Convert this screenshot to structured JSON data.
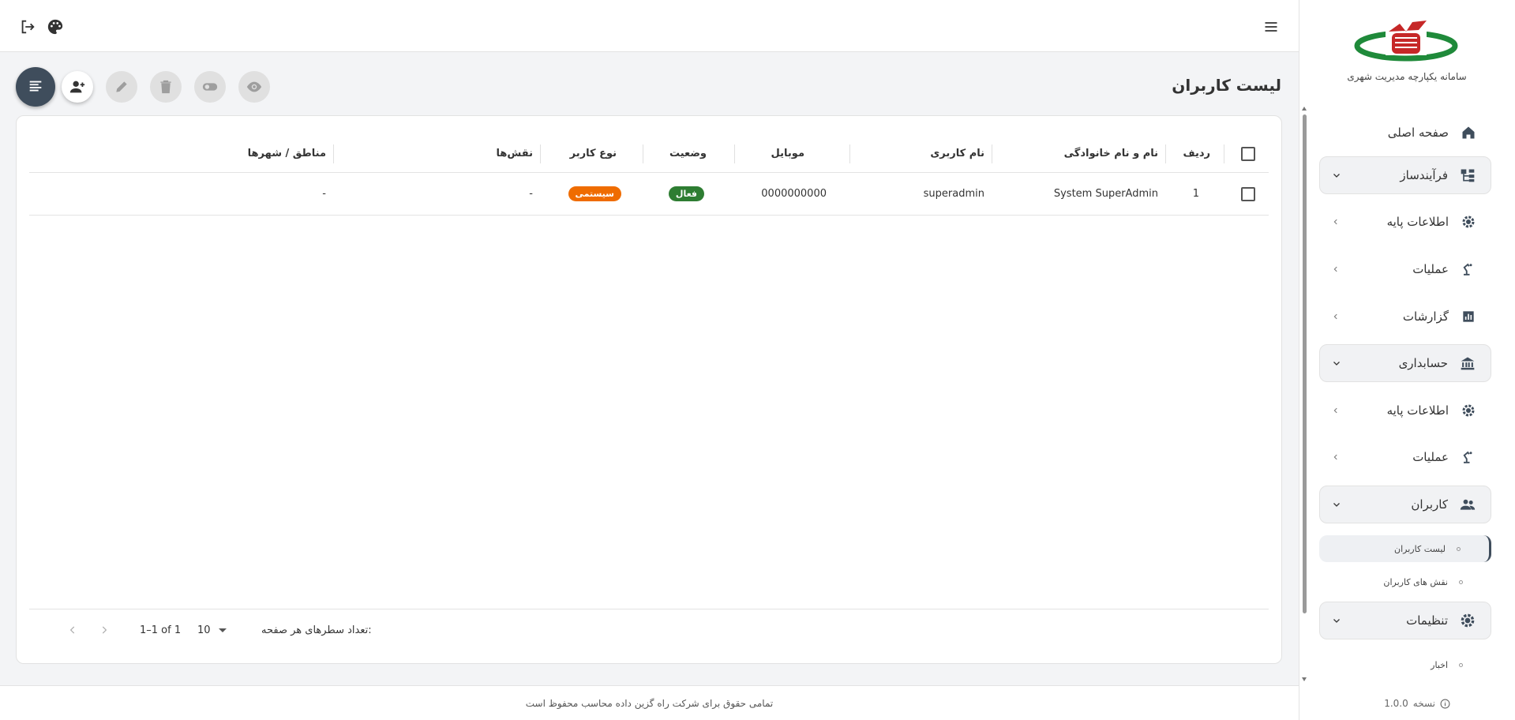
{
  "app": {
    "name": "سامانه یکپارچه مدیریت شهری",
    "version_label": "نسخه",
    "version": "1.0.0",
    "copyright": "تمامی حقوق برای شرکت راه گزین داده محاسب محفوظ است"
  },
  "sidebar": {
    "home": "صفحه اصلی",
    "groups": [
      {
        "label": "فرآیندساز",
        "icon": "process-builder-icon"
      },
      {
        "label": "حسابداری",
        "icon": "bank-icon"
      },
      {
        "label": "کاربران",
        "icon": "people-icon"
      },
      {
        "label": "تنظیمات",
        "icon": "gear-icon"
      }
    ],
    "process_items": [
      "اطلاعات پایه",
      "عملیات",
      "گزارشات"
    ],
    "accounting_items": [
      "اطلاعات پایه",
      "عملیات"
    ],
    "users_items": [
      "لیست کاربران",
      "نقش های کاربران"
    ],
    "settings_items": [
      "اخبار"
    ]
  },
  "page": {
    "title": "لیست کاربران"
  },
  "table": {
    "columns": [
      "ردیف",
      "نام و نام خانوادگی",
      "نام کاربری",
      "موبایل",
      "وضعیت",
      "نوع کاربر",
      "نقش‌ها",
      "مناطق / شهرها"
    ],
    "rows": [
      {
        "index": "1",
        "full_name": "System SuperAdmin",
        "username": "superadmin",
        "mobile": "0000000000",
        "status": "فعال",
        "user_type": "سیستمی",
        "roles": "-",
        "regions": "-"
      }
    ]
  },
  "pagination": {
    "rows_per_page_label": "تعداد سطرهای هر صفحه:",
    "rows_per_page": "10",
    "range": "1–1 of 1"
  },
  "colors": {
    "primary": "#3f4d5c",
    "active_badge": "#2e7d32",
    "system_badge": "#ef6c00"
  }
}
